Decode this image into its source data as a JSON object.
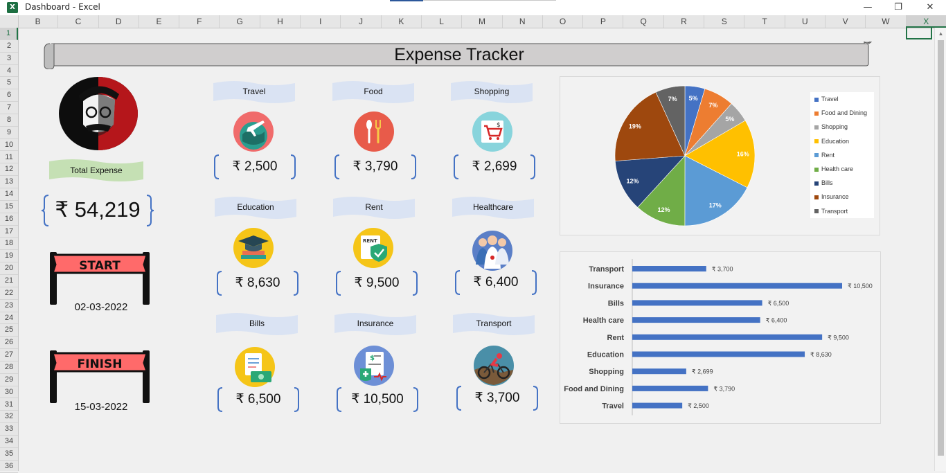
{
  "window": {
    "title": "Dashboard - Excel",
    "app_icon_letter": "X",
    "controls": {
      "minimize": "—",
      "restore": "❐",
      "close": "✕"
    }
  },
  "columns": [
    "B",
    "C",
    "D",
    "E",
    "F",
    "G",
    "H",
    "I",
    "J",
    "K",
    "L",
    "M",
    "N",
    "O",
    "P",
    "Q",
    "R",
    "S",
    "T",
    "U",
    "V",
    "W",
    "X"
  ],
  "selected_column": "X",
  "rows": [
    "1",
    "2",
    "3",
    "4",
    "5",
    "6",
    "7",
    "8",
    "9",
    "10",
    "11",
    "12",
    "13",
    "14",
    "15",
    "16",
    "17",
    "18",
    "19",
    "20",
    "21",
    "22",
    "23",
    "24",
    "25",
    "26",
    "27",
    "28",
    "29",
    "30",
    "31",
    "32",
    "33",
    "34",
    "35",
    "36"
  ],
  "selected_row": "1",
  "dashboard": {
    "title": "Expense Tracker",
    "total_label": "Total Expense",
    "total_value": "₹ 54,219",
    "start_banner": "START",
    "start_date": "02-03-2022",
    "finish_banner": "FINISH",
    "finish_date": "15-03-2022",
    "categories": [
      {
        "label": "Travel",
        "amount": "₹ 2,500",
        "icon": "globe-plane-icon"
      },
      {
        "label": "Food",
        "amount": "₹ 3,790",
        "icon": "fork-spoon-icon"
      },
      {
        "label": "Shopping",
        "amount": "₹ 2,699",
        "icon": "shopping-cart-icon"
      },
      {
        "label": "Education",
        "amount": "₹ 8,630",
        "icon": "graduation-cap-icon"
      },
      {
        "label": "Rent",
        "amount": "₹ 9,500",
        "icon": "rent-shield-icon"
      },
      {
        "label": "Healthcare",
        "amount": "₹ 6,400",
        "icon": "doctors-icon"
      },
      {
        "label": "Bills",
        "amount": "₹ 6,500",
        "icon": "bill-money-icon"
      },
      {
        "label": "Insurance",
        "amount": "₹ 10,500",
        "icon": "insurance-doc-icon"
      },
      {
        "label": "Transport",
        "amount": "₹ 3,700",
        "icon": "cyclist-icon"
      }
    ]
  },
  "chart_data": [
    {
      "type": "pie",
      "title": "",
      "labels": [
        "Travel",
        "Food and Dining",
        "Shopping",
        "Education",
        "Rent",
        "Health care",
        "Bills",
        "Insurance",
        "Transport"
      ],
      "data_labels": [
        "5%",
        "7%",
        "5%",
        "16%",
        "17%",
        "12%",
        "12%",
        "19%",
        "7%"
      ],
      "values": [
        2500,
        3790,
        2699,
        8630,
        9500,
        6400,
        6500,
        10500,
        3700
      ],
      "colors": [
        "#4472c4",
        "#ed7d31",
        "#a5a5a5",
        "#ffc000",
        "#5b9bd5",
        "#70ad47",
        "#264478",
        "#9e480e",
        "#636363"
      ],
      "legend": "right"
    },
    {
      "type": "bar",
      "orientation": "horizontal",
      "title": "",
      "categories": [
        "Transport",
        "Insurance",
        "Bills",
        "Health care",
        "Rent",
        "Education",
        "Shopping",
        "Food and Dining",
        "Travel"
      ],
      "values": [
        3700,
        10500,
        6500,
        6400,
        9500,
        8630,
        2699,
        3790,
        2500
      ],
      "data_labels": [
        "₹ 3,700",
        "₹ 10,500",
        "₹ 6,500",
        "₹ 6,400",
        "₹ 9,500",
        "₹ 8,630",
        "₹ 2,699",
        "₹ 3,790",
        "₹ 2,500"
      ],
      "xlim": [
        0,
        10500
      ],
      "color": "#4472c4",
      "grid": false
    }
  ]
}
